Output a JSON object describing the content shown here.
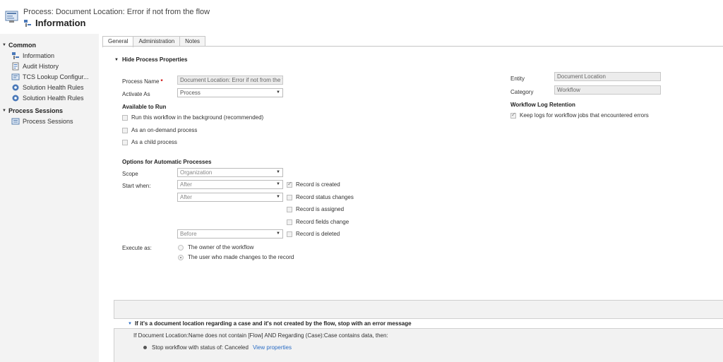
{
  "header": {
    "title": "Process: Document Location: Error if not from the flow",
    "subtitle": "Information"
  },
  "sidebar": {
    "groups": [
      {
        "label": "Common",
        "items": [
          "Information",
          "Audit History",
          "TCS Lookup Configur...",
          "Solution Health Rules",
          "Solution Health Rules"
        ]
      },
      {
        "label": "Process Sessions",
        "items": [
          "Process Sessions"
        ]
      }
    ]
  },
  "tabs": [
    "General",
    "Administration",
    "Notes"
  ],
  "section": {
    "title": "Hide Process Properties"
  },
  "form": {
    "process_name_label": "Process Name",
    "process_name_value": "Document Location: Error if not from the flow",
    "activate_as_label": "Activate As",
    "activate_as_value": "Process",
    "available_to_run_label": "Available to Run",
    "run_background": "Run this workflow in the background (recommended)",
    "on_demand": "As an on-demand process",
    "child_process": "As a child process",
    "options_label": "Options for Automatic Processes",
    "scope_label": "Scope",
    "scope_value": "Organization",
    "start_when_label": "Start when:",
    "start_when_1": "After",
    "start_when_2": "After",
    "start_when_3": "Before",
    "record_created": "Record is created",
    "record_status_changes": "Record status changes",
    "record_assigned": "Record is assigned",
    "record_fields_change": "Record fields change",
    "record_deleted": "Record is deleted",
    "execute_as_label": "Execute as:",
    "execute_owner": "The owner of the workflow",
    "execute_user": "The user who made changes to the record",
    "entity_label": "Entity",
    "entity_value": "Document Location",
    "category_label": "Category",
    "category_value": "Workflow",
    "log_retention_label": "Workflow Log Retention",
    "keep_logs": "Keep logs for workflow jobs that encountered errors"
  },
  "checked": {
    "run_background": false,
    "on_demand": false,
    "child_process": false,
    "record_created": true,
    "record_status_changes": false,
    "record_assigned": false,
    "record_fields_change": false,
    "record_deleted": false,
    "keep_logs": true
  },
  "steps": {
    "title": "If it's a document location regarding a case and it's not created by the flow, stop with an error message",
    "condition": "If Document Location:Name does not contain [Flow] AND Regarding (Case):Case contains data, then:",
    "action": "Stop workflow with status of:  Canceled",
    "view_link": "View properties"
  }
}
